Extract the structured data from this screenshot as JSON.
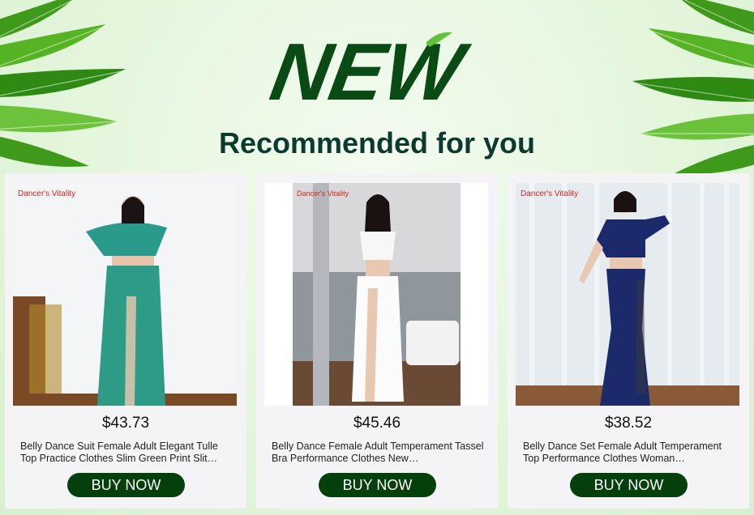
{
  "banner": {
    "hero_text": "NEW",
    "subtitle": "Recommended for you"
  },
  "products": [
    {
      "brand": "Dancer's Vitality",
      "price": "$43.73",
      "title": "Belly Dance Suit Female Adult Elegant Tulle Top Practice Clothes Slim Green Print Slit…",
      "button": "BUY NOW"
    },
    {
      "brand": "Dancer's Vitality",
      "price": "$45.46",
      "title": "Belly Dance Female Adult Temperament Tassel Bra Performance Clothes New…",
      "button": "BUY NOW"
    },
    {
      "brand": "Dancer's Vitality",
      "price": "$38.52",
      "title": "Belly Dance Set Female Adult Temperament Top Performance Clothes Woman…",
      "button": "BUY NOW"
    }
  ],
  "colors": {
    "background": "#e4f6dc",
    "title_green": "#0c3a2e",
    "button": "#043f0c",
    "brand_red": "#d8261e"
  }
}
